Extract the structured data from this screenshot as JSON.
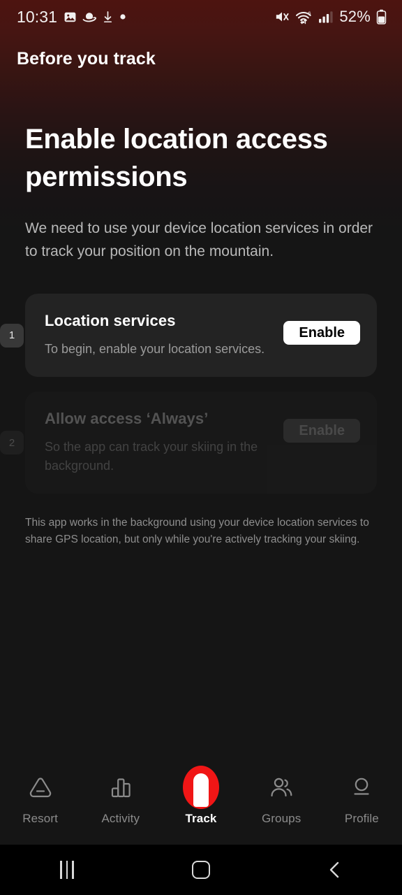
{
  "status_bar": {
    "time": "10:31",
    "left_icons": [
      "image-icon",
      "planet-icon",
      "download-icon",
      "dot-icon"
    ],
    "right_icons": [
      "mute-icon",
      "wifi-icon",
      "cellular-signal-icon"
    ],
    "battery_percent": "52%",
    "wifi_label": "6"
  },
  "header": {
    "title": "Before you track"
  },
  "main": {
    "title": "Enable location access permissions",
    "subtitle": "We need to use your device location services in order to track your position on the mountain.",
    "steps": [
      {
        "badge": "1",
        "title": "Location services",
        "description": "To begin, enable your location services.",
        "button_label": "Enable",
        "enabled": true
      },
      {
        "badge": "2",
        "title": "Allow access ‘Always’",
        "description": "So the app can track your skiing in the background.",
        "button_label": "Enable",
        "enabled": false
      }
    ],
    "disclaimer": "This app works in the background using your device location services to share GPS location, but only while you're actively tracking your skiing."
  },
  "tabbar": {
    "items": [
      {
        "label": "Resort",
        "icon": "mountain-icon",
        "active": false
      },
      {
        "label": "Activity",
        "icon": "bar-chart-icon",
        "active": false
      },
      {
        "label": "Track",
        "icon": "track-icon",
        "active": true
      },
      {
        "label": "Groups",
        "icon": "people-icon",
        "active": false
      },
      {
        "label": "Profile",
        "icon": "person-icon",
        "active": false
      }
    ]
  },
  "android_nav": {
    "recents_label": "recents-icon",
    "home_label": "home-icon",
    "back_label": "back-icon"
  },
  "colors": {
    "accent_red": "#f01616",
    "gradient_top": "#4d1410",
    "background": "#151515",
    "card": "#232323",
    "card_disabled": "#1b1b1b"
  }
}
